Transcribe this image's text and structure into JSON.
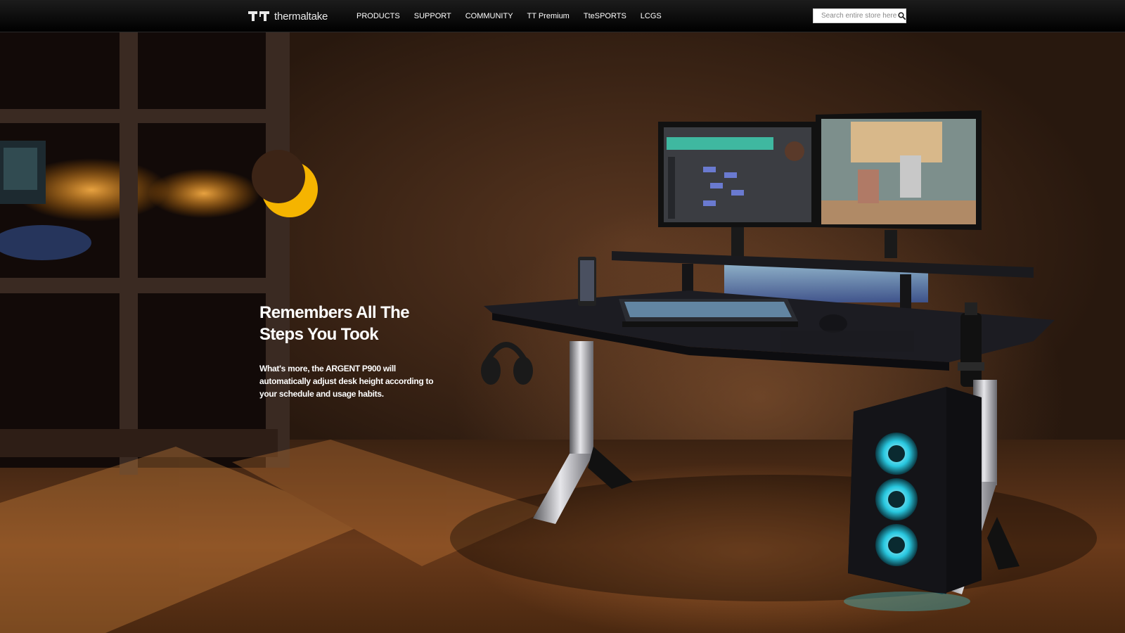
{
  "brand": {
    "logo_text": "thermaltake"
  },
  "nav": {
    "items": [
      {
        "label": "PRODUCTS"
      },
      {
        "label": "SUPPORT"
      },
      {
        "label": "COMMUNITY"
      },
      {
        "label": "TT Premium"
      },
      {
        "label": "TteSPORTS"
      },
      {
        "label": "LCGS"
      }
    ]
  },
  "search": {
    "placeholder": "Search entire store here...",
    "button_icon": "search-icon"
  },
  "hero": {
    "title": "Remembers All The Steps You Took",
    "body": "What's more, the ARGENT P900 will automatically adjust desk height according to your schedule and usage habits.",
    "moon_icon": "crescent-moon-icon"
  },
  "colors": {
    "nav_background": "#000000",
    "moon": "#f5b400",
    "accent_light": "#7fd8f0",
    "text": "#ffffff"
  }
}
